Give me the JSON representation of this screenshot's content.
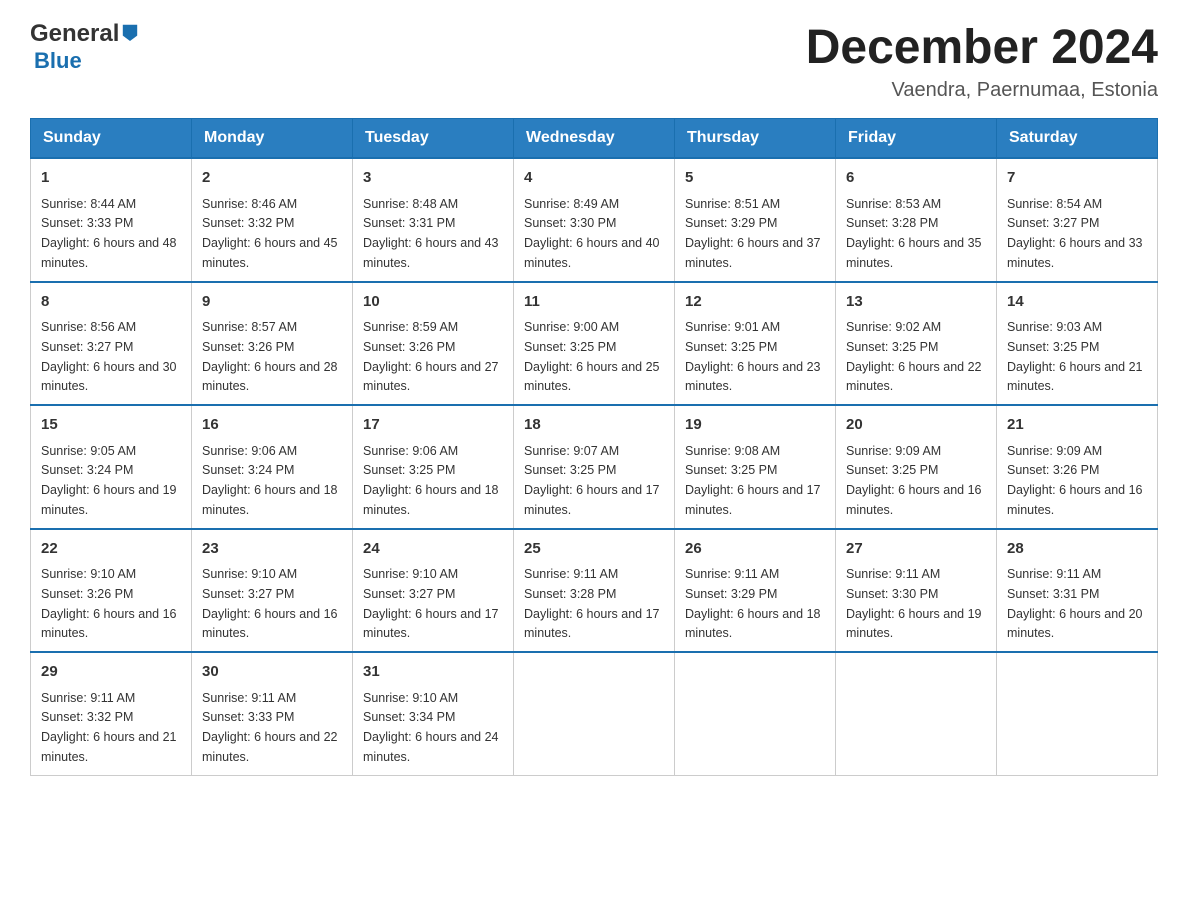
{
  "header": {
    "logo_general": "General",
    "logo_blue": "Blue",
    "month_title": "December 2024",
    "location": "Vaendra, Paernumaa, Estonia"
  },
  "weekdays": [
    "Sunday",
    "Monday",
    "Tuesday",
    "Wednesday",
    "Thursday",
    "Friday",
    "Saturday"
  ],
  "weeks": [
    [
      {
        "day": "1",
        "sunrise": "8:44 AM",
        "sunset": "3:33 PM",
        "daylight": "6 hours and 48 minutes."
      },
      {
        "day": "2",
        "sunrise": "8:46 AM",
        "sunset": "3:32 PM",
        "daylight": "6 hours and 45 minutes."
      },
      {
        "day": "3",
        "sunrise": "8:48 AM",
        "sunset": "3:31 PM",
        "daylight": "6 hours and 43 minutes."
      },
      {
        "day": "4",
        "sunrise": "8:49 AM",
        "sunset": "3:30 PM",
        "daylight": "6 hours and 40 minutes."
      },
      {
        "day": "5",
        "sunrise": "8:51 AM",
        "sunset": "3:29 PM",
        "daylight": "6 hours and 37 minutes."
      },
      {
        "day": "6",
        "sunrise": "8:53 AM",
        "sunset": "3:28 PM",
        "daylight": "6 hours and 35 minutes."
      },
      {
        "day": "7",
        "sunrise": "8:54 AM",
        "sunset": "3:27 PM",
        "daylight": "6 hours and 33 minutes."
      }
    ],
    [
      {
        "day": "8",
        "sunrise": "8:56 AM",
        "sunset": "3:27 PM",
        "daylight": "6 hours and 30 minutes."
      },
      {
        "day": "9",
        "sunrise": "8:57 AM",
        "sunset": "3:26 PM",
        "daylight": "6 hours and 28 minutes."
      },
      {
        "day": "10",
        "sunrise": "8:59 AM",
        "sunset": "3:26 PM",
        "daylight": "6 hours and 27 minutes."
      },
      {
        "day": "11",
        "sunrise": "9:00 AM",
        "sunset": "3:25 PM",
        "daylight": "6 hours and 25 minutes."
      },
      {
        "day": "12",
        "sunrise": "9:01 AM",
        "sunset": "3:25 PM",
        "daylight": "6 hours and 23 minutes."
      },
      {
        "day": "13",
        "sunrise": "9:02 AM",
        "sunset": "3:25 PM",
        "daylight": "6 hours and 22 minutes."
      },
      {
        "day": "14",
        "sunrise": "9:03 AM",
        "sunset": "3:25 PM",
        "daylight": "6 hours and 21 minutes."
      }
    ],
    [
      {
        "day": "15",
        "sunrise": "9:05 AM",
        "sunset": "3:24 PM",
        "daylight": "6 hours and 19 minutes."
      },
      {
        "day": "16",
        "sunrise": "9:06 AM",
        "sunset": "3:24 PM",
        "daylight": "6 hours and 18 minutes."
      },
      {
        "day": "17",
        "sunrise": "9:06 AM",
        "sunset": "3:25 PM",
        "daylight": "6 hours and 18 minutes."
      },
      {
        "day": "18",
        "sunrise": "9:07 AM",
        "sunset": "3:25 PM",
        "daylight": "6 hours and 17 minutes."
      },
      {
        "day": "19",
        "sunrise": "9:08 AM",
        "sunset": "3:25 PM",
        "daylight": "6 hours and 17 minutes."
      },
      {
        "day": "20",
        "sunrise": "9:09 AM",
        "sunset": "3:25 PM",
        "daylight": "6 hours and 16 minutes."
      },
      {
        "day": "21",
        "sunrise": "9:09 AM",
        "sunset": "3:26 PM",
        "daylight": "6 hours and 16 minutes."
      }
    ],
    [
      {
        "day": "22",
        "sunrise": "9:10 AM",
        "sunset": "3:26 PM",
        "daylight": "6 hours and 16 minutes."
      },
      {
        "day": "23",
        "sunrise": "9:10 AM",
        "sunset": "3:27 PM",
        "daylight": "6 hours and 16 minutes."
      },
      {
        "day": "24",
        "sunrise": "9:10 AM",
        "sunset": "3:27 PM",
        "daylight": "6 hours and 17 minutes."
      },
      {
        "day": "25",
        "sunrise": "9:11 AM",
        "sunset": "3:28 PM",
        "daylight": "6 hours and 17 minutes."
      },
      {
        "day": "26",
        "sunrise": "9:11 AM",
        "sunset": "3:29 PM",
        "daylight": "6 hours and 18 minutes."
      },
      {
        "day": "27",
        "sunrise": "9:11 AM",
        "sunset": "3:30 PM",
        "daylight": "6 hours and 19 minutes."
      },
      {
        "day": "28",
        "sunrise": "9:11 AM",
        "sunset": "3:31 PM",
        "daylight": "6 hours and 20 minutes."
      }
    ],
    [
      {
        "day": "29",
        "sunrise": "9:11 AM",
        "sunset": "3:32 PM",
        "daylight": "6 hours and 21 minutes."
      },
      {
        "day": "30",
        "sunrise": "9:11 AM",
        "sunset": "3:33 PM",
        "daylight": "6 hours and 22 minutes."
      },
      {
        "day": "31",
        "sunrise": "9:10 AM",
        "sunset": "3:34 PM",
        "daylight": "6 hours and 24 minutes."
      },
      null,
      null,
      null,
      null
    ]
  ],
  "labels": {
    "sunrise_prefix": "Sunrise: ",
    "sunset_prefix": "Sunset: ",
    "daylight_prefix": "Daylight: "
  }
}
